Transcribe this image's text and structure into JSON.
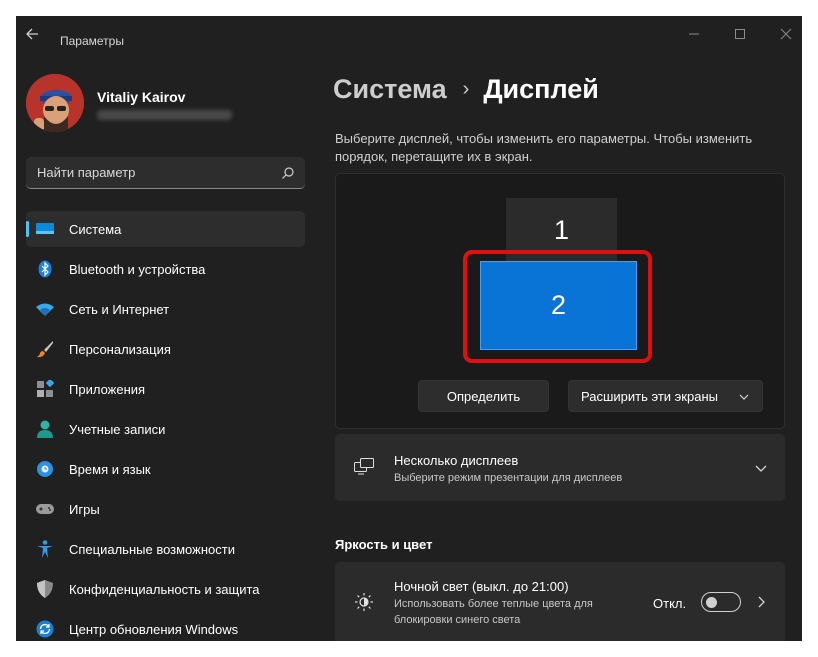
{
  "window": {
    "title": "Параметры"
  },
  "profile": {
    "name": "Vitaliy Kairov",
    "email_blurred": true
  },
  "search": {
    "placeholder": "Найти параметр"
  },
  "nav": {
    "items": [
      {
        "label": "Система",
        "icon": "system-icon",
        "active": true
      },
      {
        "label": "Bluetooth и устройства",
        "icon": "bluetooth-icon"
      },
      {
        "label": "Сеть и Интернет",
        "icon": "wifi-icon"
      },
      {
        "label": "Персонализация",
        "icon": "brush-icon"
      },
      {
        "label": "Приложения",
        "icon": "apps-icon"
      },
      {
        "label": "Учетные записи",
        "icon": "person-icon"
      },
      {
        "label": "Время и язык",
        "icon": "globe-clock-icon"
      },
      {
        "label": "Игры",
        "icon": "gamepad-icon"
      },
      {
        "label": "Специальные возможности",
        "icon": "accessibility-icon"
      },
      {
        "label": "Конфиденциальность и защита",
        "icon": "shield-icon"
      },
      {
        "label": "Центр обновления Windows",
        "icon": "update-icon"
      }
    ]
  },
  "breadcrumb": {
    "parent": "Система",
    "separator": "›",
    "current": "Дисплей"
  },
  "main": {
    "description": "Выберите дисплей, чтобы изменить его параметры. Чтобы изменить порядок, перетащите их в экран.",
    "monitors": [
      "1",
      "2"
    ],
    "selected_monitor": "2",
    "identify_button": "Определить",
    "extend_dropdown": "Расширить эти экраны",
    "multi_display": {
      "title": "Несколько дисплеев",
      "subtitle": "Выберите режим презентации для дисплеев"
    },
    "section_brightness": "Яркость и цвет",
    "night_light": {
      "title": "Ночной свет (выкл. до 21:00)",
      "subtitle_line1": "Использовать более теплые цвета для",
      "subtitle_line2": "блокировки синего света",
      "toggle_state": "Откл."
    }
  },
  "colors": {
    "window_bg": "#202020",
    "accent": "#4cc2ff",
    "selected_monitor": "#0a74d6",
    "highlight": "#e01010"
  }
}
